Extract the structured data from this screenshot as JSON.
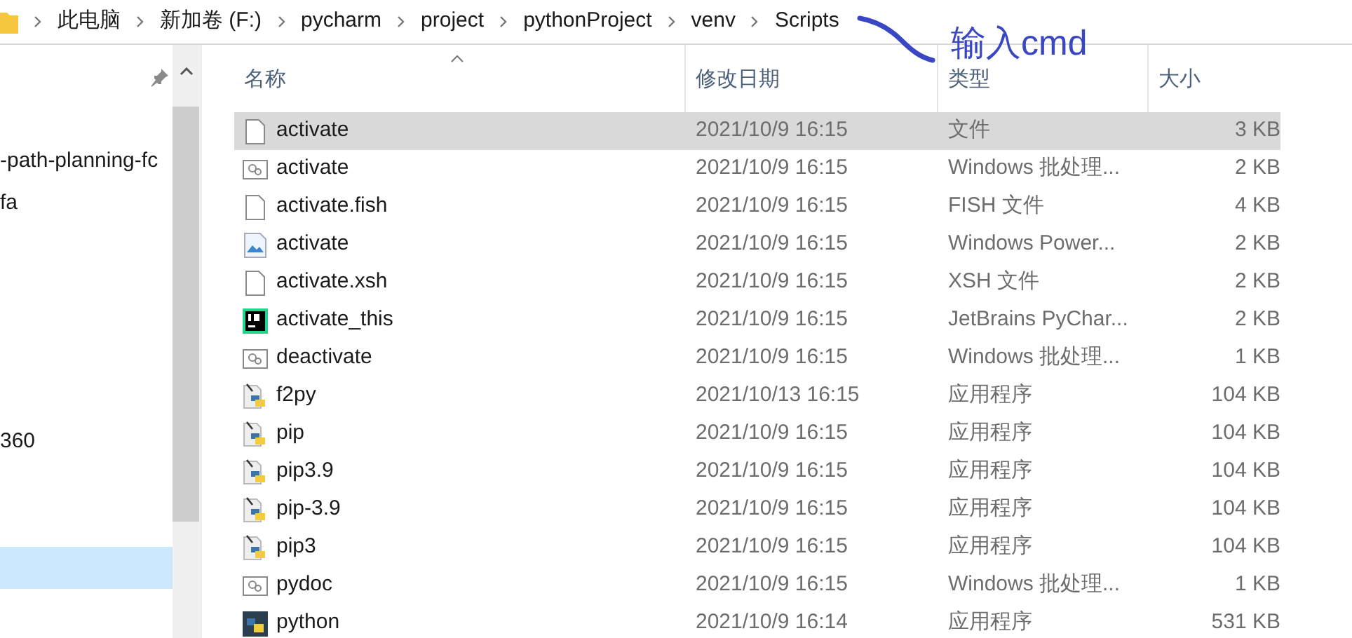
{
  "breadcrumb": [
    "此电脑",
    "新加卷 (F:)",
    "pycharm",
    "project",
    "pythonProject",
    "venv",
    "Scripts"
  ],
  "annotation": {
    "text": "输入cmd"
  },
  "sidebar": {
    "items": [
      {
        "label": "-path-planning-fc",
        "selected": false
      },
      {
        "label": "fa",
        "selected": false
      },
      {
        "label": "360",
        "selected": false
      },
      {
        "selected": true
      }
    ]
  },
  "table": {
    "columns": [
      "名称",
      "修改日期",
      "类型",
      "大小"
    ],
    "rows": [
      {
        "kind": "blank",
        "name": "activate",
        "date": "2021/10/9 16:15",
        "type": "文件",
        "size": "3 KB",
        "selected": true
      },
      {
        "kind": "batch",
        "name": "activate",
        "date": "2021/10/9 16:15",
        "type": "Windows 批处理...",
        "size": "2 KB",
        "selected": false
      },
      {
        "kind": "blank",
        "name": "activate.fish",
        "date": "2021/10/9 16:15",
        "type": "FISH 文件",
        "size": "4 KB",
        "selected": false
      },
      {
        "kind": "powershell",
        "name": "activate",
        "date": "2021/10/9 16:15",
        "type": "Windows Power...",
        "size": "2 KB",
        "selected": false
      },
      {
        "kind": "blank",
        "name": "activate.xsh",
        "date": "2021/10/9 16:15",
        "type": "XSH 文件",
        "size": "2 KB",
        "selected": false
      },
      {
        "kind": "pycharm",
        "name": "activate_this",
        "date": "2021/10/9 16:15",
        "type": "JetBrains PyChar...",
        "size": "2 KB",
        "selected": false
      },
      {
        "kind": "batch",
        "name": "deactivate",
        "date": "2021/10/9 16:15",
        "type": "Windows 批处理...",
        "size": "1 KB",
        "selected": false
      },
      {
        "kind": "python",
        "name": "f2py",
        "date": "2021/10/13 16:15",
        "type": "应用程序",
        "size": "104 KB",
        "selected": false
      },
      {
        "kind": "python",
        "name": "pip",
        "date": "2021/10/9 16:15",
        "type": "应用程序",
        "size": "104 KB",
        "selected": false
      },
      {
        "kind": "python",
        "name": "pip3.9",
        "date": "2021/10/9 16:15",
        "type": "应用程序",
        "size": "104 KB",
        "selected": false
      },
      {
        "kind": "python",
        "name": "pip-3.9",
        "date": "2021/10/9 16:15",
        "type": "应用程序",
        "size": "104 KB",
        "selected": false
      },
      {
        "kind": "python",
        "name": "pip3",
        "date": "2021/10/9 16:15",
        "type": "应用程序",
        "size": "104 KB",
        "selected": false
      },
      {
        "kind": "batch",
        "name": "pydoc",
        "date": "2021/10/9 16:15",
        "type": "Windows 批处理...",
        "size": "1 KB",
        "selected": false
      },
      {
        "kind": "pythonexe",
        "name": "python",
        "date": "2021/10/9 16:14",
        "type": "应用程序",
        "size": "531 KB",
        "selected": false
      }
    ]
  }
}
